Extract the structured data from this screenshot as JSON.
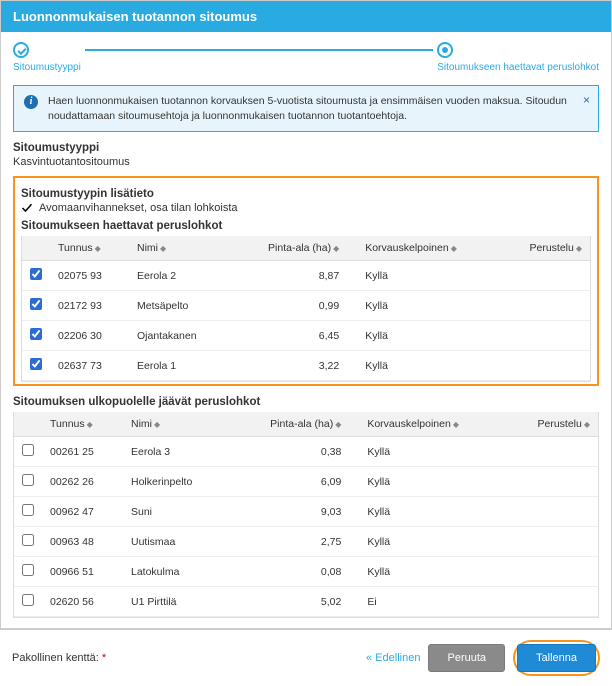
{
  "header": {
    "title": "Luonnonmukaisen tuotannon sitoumus"
  },
  "stepper": {
    "step1": "Sitoumustyyppi",
    "step2": "Sitoumukseen haettavat peruslohkot"
  },
  "alert": {
    "text": "Haen luonnonmukaisen tuotannon korvauksen 5-vuotista sitoumusta ja ensimmäisen vuoden maksua. Sitoudun noudattamaan sitoumusehtoja ja luonnonmukaisen tuotannon tuotantoehtoja."
  },
  "type": {
    "label": "Sitoumustyyppi",
    "value": "Kasvintuotantositoumus"
  },
  "extra": {
    "label": "Sitoumustyypin lisätieto",
    "value": "Avomaanvihannekset, osa tilan lohkoista"
  },
  "cols": {
    "tunnus": "Tunnus",
    "nimi": "Nimi",
    "pinta": "Pinta-ala (ha)",
    "korv": "Korvauskelpoinen",
    "peru": "Perustelu"
  },
  "included": {
    "title": "Sitoumukseen haettavat peruslohkot",
    "rows": [
      {
        "c": true,
        "t": "02075 93",
        "n": "Eerola 2",
        "p": "8,87",
        "k": "Kyllä",
        "r": ""
      },
      {
        "c": true,
        "t": "02172 93",
        "n": "Metsäpelto",
        "p": "0,99",
        "k": "Kyllä",
        "r": ""
      },
      {
        "c": true,
        "t": "02206 30",
        "n": "Ojantakanen",
        "p": "6,45",
        "k": "Kyllä",
        "r": ""
      },
      {
        "c": true,
        "t": "02637 73",
        "n": "Eerola 1",
        "p": "3,22",
        "k": "Kyllä",
        "r": ""
      }
    ]
  },
  "excluded": {
    "title": "Sitoumuksen ulkopuolelle jäävät peruslohkot",
    "rows": [
      {
        "c": false,
        "t": "00261 25",
        "n": "Eerola 3",
        "p": "0,38",
        "k": "Kyllä",
        "r": ""
      },
      {
        "c": false,
        "t": "00262 26",
        "n": "Holkerinpelto",
        "p": "6,09",
        "k": "Kyllä",
        "r": ""
      },
      {
        "c": false,
        "t": "00962 47",
        "n": "Suni",
        "p": "9,03",
        "k": "Kyllä",
        "r": ""
      },
      {
        "c": false,
        "t": "00963 48",
        "n": "Uutismaa",
        "p": "2,75",
        "k": "Kyllä",
        "r": ""
      },
      {
        "c": false,
        "t": "00966 51",
        "n": "Latokulma",
        "p": "0,08",
        "k": "Kyllä",
        "r": ""
      },
      {
        "c": false,
        "t": "02620 56",
        "n": "U1 Pirttilä",
        "p": "5,02",
        "k": "Ei",
        "r": ""
      }
    ]
  },
  "footer": {
    "required": "Pakollinen kenttä: ",
    "prev_prefix": "« ",
    "prev": "Edellinen",
    "cancel": "Peruuta",
    "save": "Tallenna"
  }
}
